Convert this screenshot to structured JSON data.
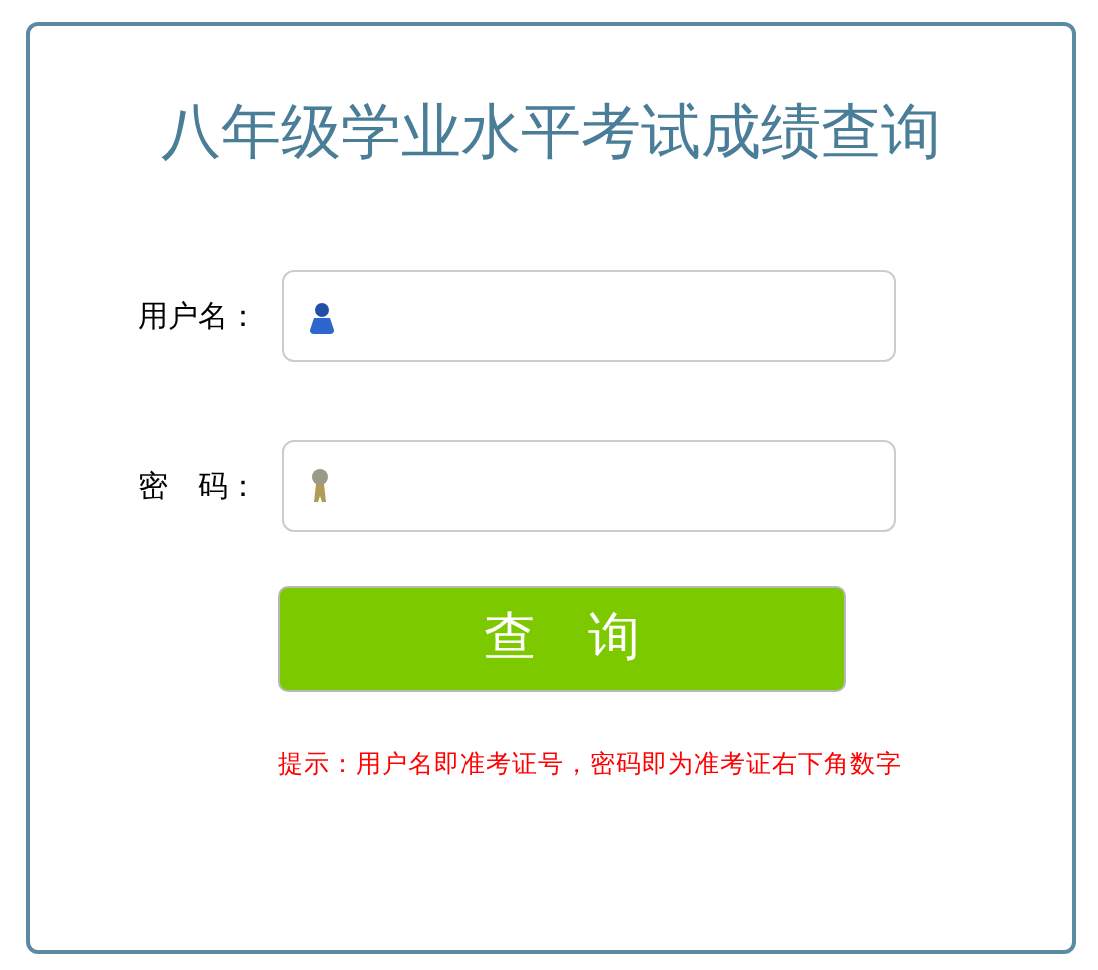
{
  "title": "八年级学业水平考试成绩查询",
  "fields": [
    {
      "label": "用户名：",
      "kind": "user"
    },
    {
      "label": "密　码：",
      "kind": "password"
    }
  ],
  "submit": "查　询",
  "hint": "提示：用户名即准考证号，密码即为准考证右下角数字"
}
